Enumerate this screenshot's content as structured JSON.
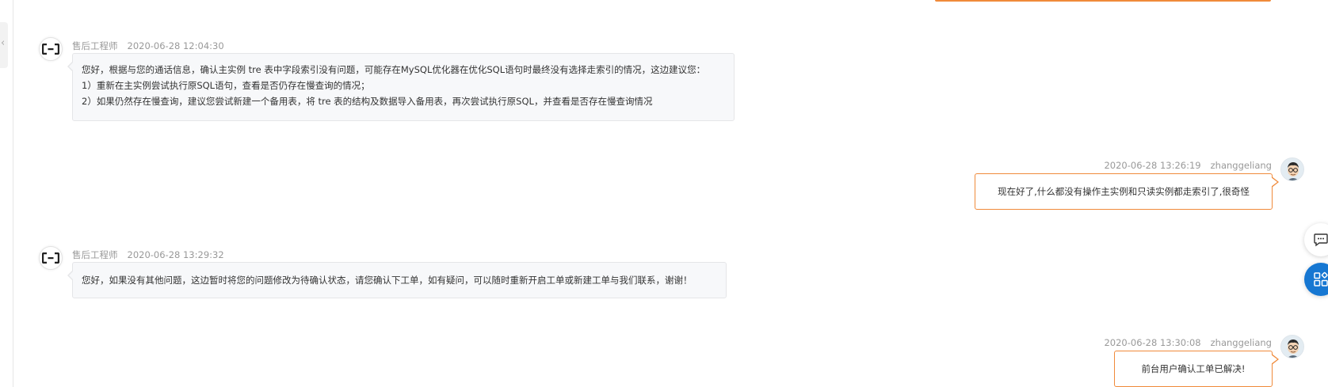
{
  "conversation": {
    "messages": [
      {
        "sender": "售后工程师",
        "time": "2020-06-28 12:04:30",
        "side": "left",
        "lines": [
          "您好，根据与您的通话信息，确认主实例 tre 表中字段索引没有问题，可能存在MySQL优化器在优化SQL语句时最终没有选择走索引的情况，这边建议您：",
          "1）重新在主实例尝试执行原SQL语句，查看是否仍存在慢查询的情况；",
          "2）如果仍然存在慢查询，建议您尝试新建一个备用表，将 tre 表的结构及数据导入备用表，再次尝试执行原SQL，并查看是否存在慢查询情况"
        ]
      },
      {
        "sender": "zhanggeliang",
        "time": "2020-06-28 13:26:19",
        "side": "right",
        "lines": [
          "现在好了,什么都没有操作主实例和只读实例都走索引了,很奇怪"
        ]
      },
      {
        "sender": "售后工程师",
        "time": "2020-06-28 13:29:32",
        "side": "left",
        "lines": [
          "您好，如果没有其他问题，这边暂时将您的问题修改为待确认状态，请您确认下工单，如有疑问，可以随时重新开启工单或新建工单与我们联系，谢谢！"
        ]
      },
      {
        "sender": "zhanggeliang",
        "time": "2020-06-28 13:30:08",
        "side": "right",
        "lines": [
          "前台用户确认工单已解决!"
        ]
      }
    ]
  },
  "icons": {
    "engineer_avatar": "aliyun-logo-icon",
    "user_avatar": "user-cartoon-avatar-icon",
    "collapse": "chevron-left-icon",
    "chat": "chat-bubble-icon",
    "apps": "apps-grid-icon"
  },
  "colors": {
    "accent_orange": "#f08a3a",
    "primary_blue": "#1677d2",
    "bubble_gray": "#f7f8fa",
    "meta_gray": "#999999"
  }
}
